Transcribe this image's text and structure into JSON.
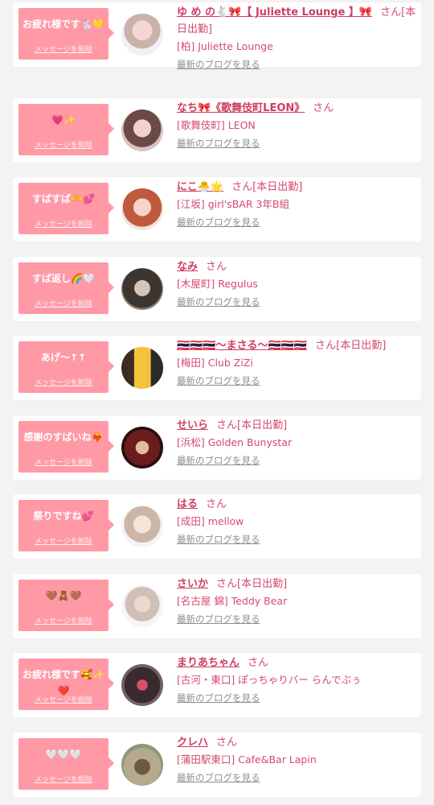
{
  "delete_label": "メッセージを削除",
  "blog_label": "最新のブログを見る",
  "honorific": "さん",
  "colors": {
    "bubble": "#ff99a6",
    "name": "#cf3d62",
    "text": "#d44a6c",
    "link_gray": "#8e8e8e"
  },
  "cards": [
    {
      "message": "お疲れ様です🐇💛",
      "name": "ゆ め の🐇🎀【 Juliette Lounge 】🎀",
      "status": "[本日出勤]",
      "shop": "[柏] Juliette Lounge",
      "avatar": "avatar-photo"
    },
    {
      "message": "💗✨",
      "name": "なち🎀《歌舞伎町LEON》",
      "status": "",
      "shop": "[歌舞伎町] LEON",
      "avatar": "avatar-photo"
    },
    {
      "message": "すばすば🫶💕",
      "name": "にこ🐣🌟",
      "status": "[本日出勤]",
      "shop": "[江坂] girl'sBAR 3年B組",
      "avatar": "avatar-photo"
    },
    {
      "message": "すば返し🌈🤍",
      "name": "なみ",
      "status": "",
      "shop": "[木屋町] Regulus",
      "avatar": "avatar-photo"
    },
    {
      "message": "あげ〜↑↑",
      "name": "🇹🇭🇹🇭🇹🇭〜まさる〜🇹🇭🇹🇭🇹🇭",
      "status": "[本日出勤]",
      "shop": "[梅田] Club ZiZi",
      "avatar": "avatar-photo"
    },
    {
      "message": "感謝のすばいね❤️‍🔥",
      "name": "せいら",
      "status": "[本日出勤]",
      "shop": "[浜松] Golden Bunystar",
      "avatar": "avatar-photo"
    },
    {
      "message": "祭りですね💕",
      "name": "はる",
      "status": "",
      "shop": "[成田] mellow",
      "avatar": "avatar-photo"
    },
    {
      "message": "🤎🧸🤎",
      "name": "さいか",
      "status": "[本日出勤]",
      "shop": "[名古屋 錦] Teddy Bear",
      "avatar": "avatar-photo"
    },
    {
      "message": "お疲れ様です🥰✨❤️",
      "name": "まりあちゃん",
      "status": "",
      "shop": "[古河・東口] ぽっちゃりバー らんでぶぅ",
      "avatar": "avatar-photo"
    },
    {
      "message": "🤍🤍🤍",
      "name": "クレハ",
      "status": "",
      "shop": "[蒲田駅東口] Cafe&Bar Lapin",
      "avatar": "avatar-photo"
    }
  ]
}
